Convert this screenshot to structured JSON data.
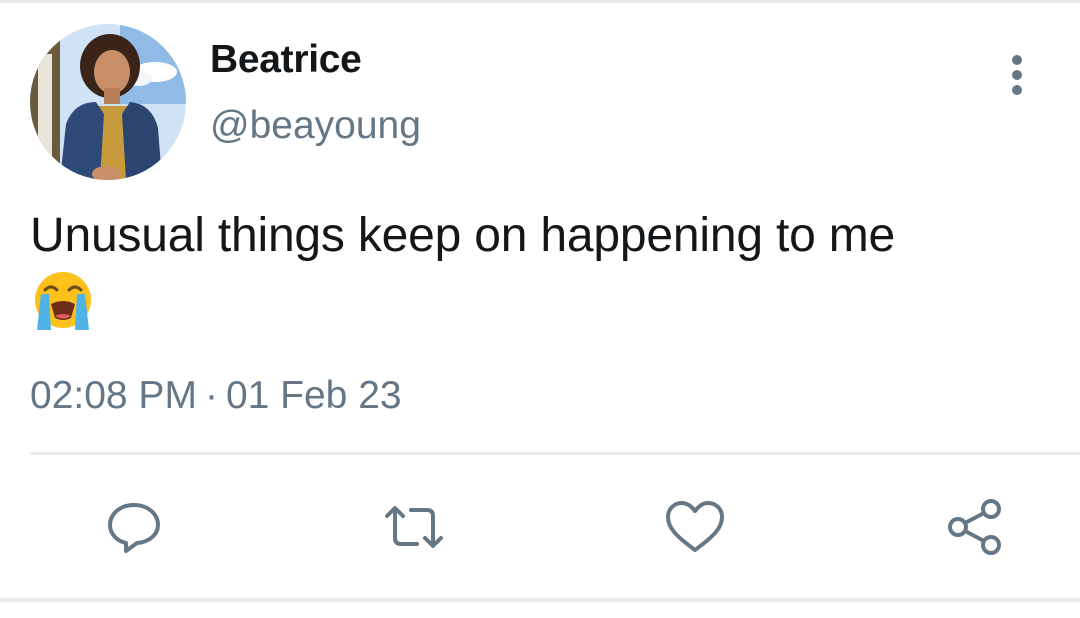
{
  "tweet": {
    "author_name": "Beatrice",
    "author_handle": "@beayoung",
    "text": "Unusual things keep on happening to me",
    "emoji": "loudly-crying-face-emoji",
    "time": "02:08 PM",
    "separator": "·",
    "date": "01 Feb 23"
  },
  "actions": {
    "reply_icon": "reply-icon",
    "retweet_icon": "retweet-icon",
    "like_icon": "heart-icon",
    "share_icon": "share-icon"
  },
  "colors": {
    "text_primary": "#14171a",
    "text_secondary": "#657786",
    "divider": "#e6ecf0",
    "background": "#ffffff"
  }
}
